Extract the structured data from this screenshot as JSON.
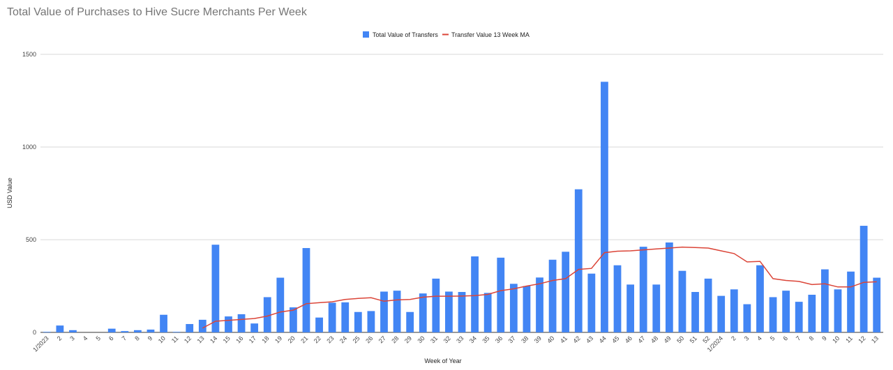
{
  "chart_data": {
    "type": "bar",
    "title": "Total Value of Purchases to Hive Sucre Merchants Per Week",
    "xlabel": "Week of Year",
    "ylabel": "USD Value",
    "ylim": [
      0,
      1500
    ],
    "yticks": [
      "0",
      "500",
      "1000",
      "1500"
    ],
    "grid": true,
    "legend_position": "top-center",
    "categories": [
      "1/2023",
      "2",
      "3",
      "4",
      "5",
      "6",
      "7",
      "8",
      "9",
      "10",
      "11",
      "12",
      "13",
      "14",
      "15",
      "16",
      "17",
      "18",
      "19",
      "20",
      "21",
      "22",
      "23",
      "24",
      "25",
      "26",
      "27",
      "28",
      "29",
      "30",
      "31",
      "32",
      "33",
      "34",
      "35",
      "36",
      "37",
      "38",
      "39",
      "40",
      "41",
      "42",
      "43",
      "44",
      "45",
      "46",
      "47",
      "48",
      "49",
      "50",
      "51",
      "52",
      "1/2024",
      "2",
      "3",
      "4",
      "5",
      "6",
      "7",
      "8",
      "9",
      "10",
      "11",
      "12",
      "13"
    ],
    "series": [
      {
        "name": "Total Value of Transfers",
        "type": "bar",
        "color": "#4285f4",
        "values": [
          3,
          37,
          12,
          0,
          0,
          20,
          7,
          12,
          15,
          95,
          3,
          45,
          68,
          473,
          86,
          98,
          48,
          190,
          295,
          135,
          455,
          80,
          160,
          162,
          110,
          115,
          220,
          225,
          110,
          210,
          290,
          220,
          218,
          410,
          213,
          403,
          262,
          250,
          296,
          392,
          435,
          772,
          317,
          1352,
          362,
          258,
          462,
          258,
          485,
          332,
          218,
          290,
          197,
          232,
          152,
          362,
          190,
          225,
          165,
          203,
          340,
          232,
          328,
          575,
          295
        ]
      },
      {
        "name": "Transfer Value 13 Week MA",
        "type": "line",
        "color": "#db4437",
        "values": [
          null,
          null,
          null,
          null,
          null,
          null,
          null,
          null,
          null,
          null,
          null,
          null,
          23,
          60,
          65,
          70,
          75,
          88,
          110,
          120,
          155,
          160,
          165,
          178,
          183,
          187,
          168,
          175,
          178,
          190,
          195,
          195,
          196,
          198,
          205,
          225,
          235,
          250,
          262,
          280,
          290,
          340,
          345,
          430,
          438,
          440,
          445,
          450,
          455,
          460,
          458,
          455,
          440,
          425,
          380,
          383,
          290,
          280,
          275,
          258,
          262,
          245,
          245,
          270,
          273
        ]
      }
    ]
  }
}
